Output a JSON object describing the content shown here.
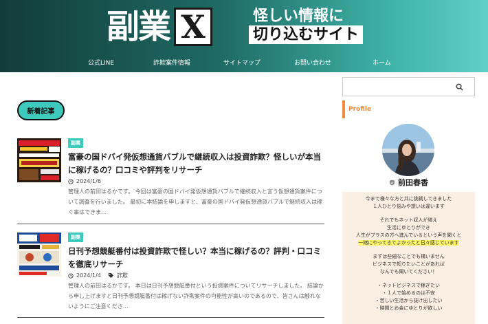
{
  "header": {
    "logo_kanji": "副業",
    "logo_x": "X",
    "tagline_1": "怪しい情報に",
    "tagline_2": "切り込むサイト"
  },
  "nav": [
    {
      "label": "公式LINE"
    },
    {
      "label": "詐欺案件情報"
    },
    {
      "label": "サイトマップ"
    },
    {
      "label": "お問い合わせ"
    },
    {
      "label": "ホーム"
    }
  ],
  "main": {
    "section_label": "新着記事",
    "posts": [
      {
        "category": "副業",
        "title": "富豪の国ドバイ発仮想通貨バブルで継続収入は投資詐欺？怪しいが本当に稼げるの？口コミや評判をリサーチ",
        "date": "2024/1/6",
        "tag": "",
        "excerpt": "管理人の前田はるかです。 今回は富豪の国ドバイ発仮想通貨バブルで継続収入と言う仮想通貨案件について調査を行いました。 最初に本結論を申しますと、富豪の国ドバイ発仮想通貨バブルで継続収入は稼ぐ事はできま…"
      },
      {
        "category": "副業",
        "title": "日刊予想競艇番付は投資詐欺で怪しい？本当に稼げるの？評判・口コミを徹底リサーチ",
        "date": "2024/1/4",
        "tag": "詐欺",
        "excerpt": "管理人の前田はるかです。 本日は日刊予想競艇番付という投資案件についてリサーチしました。 結論から申し上げますと日刊予想競艇番付は稼げない詐欺案件の可能性が高いのであるので、皆さんは触れないようにご注意くださ…"
      }
    ]
  },
  "sidebar": {
    "search_placeholder": "",
    "profile_heading": "Profile",
    "profile_name": "前田春香",
    "profile_lines": [
      "今まで様々な方と共に挑戦してきました",
      "１人ひとり悩みや想いは違います",
      "",
      "それでもネット収入が増え",
      "生活にゆとりができ",
      "人生がプラスの方へ進んでいるという声を聞くと",
      "一緒にやってきてよかったと日々感じています",
      "",
      "まずは些細なことでも構いません",
      "ビジネスで知りたいことがあれば",
      "なんでも聞いてください！",
      "",
      "・ネットビジネスで稼ぎたい",
      "・１人で始めるのは不安",
      "・苦しい生活から抜け出したい",
      "・時間とお金にゆとりが欲しい"
    ],
    "highlight_index": 6
  },
  "colors": {
    "accent": "#3ec9bd",
    "profile_accent": "#f08a3c",
    "profile_bg": "#fbeee2",
    "highlight": "#fff568"
  }
}
